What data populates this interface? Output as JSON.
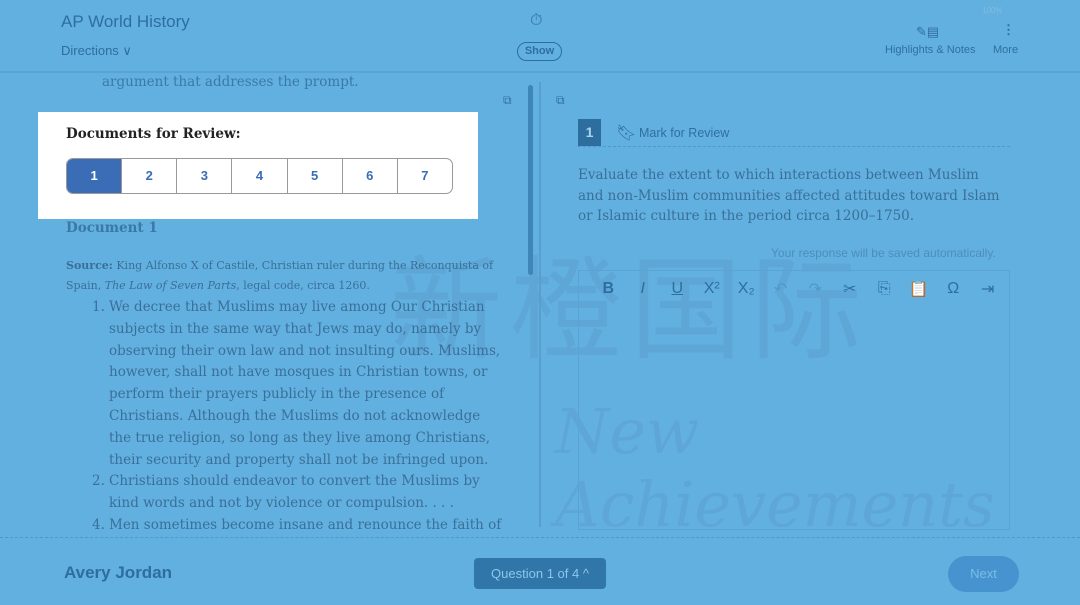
{
  "header": {
    "title": "AP World History",
    "directions": "Directions ∨",
    "battery": "100%",
    "timer_icon": "stopwatch-icon",
    "show": "Show",
    "highlights_notes": "Highlights & Notes",
    "more": "More"
  },
  "passage": {
    "argument": "argument that addresses the prompt.",
    "doc_heading": "Document 1",
    "source_label": "Source:",
    "source_text": " King Alfonso X of Castile, Christian ruler during the Reconquista of Spain, ",
    "source_title": "The Law of Seven Parts",
    "source_rest": ", legal code, circa 1260.",
    "items": [
      {
        "n": "1.",
        "text": "We decree that Muslims may live among Our Christian subjects in the same way that Jews may do, namely by observing their own law and not insulting ours. Muslims, however, shall not have mosques in Christian towns, or perform their prayers publicly in the presence of Christians. Although the Muslims do not acknowledge the true religion, so long as they live among Christians, their security and property shall not be infringed upon."
      },
      {
        "n": "2.",
        "text": "Christians should endeavor to convert the Muslims by kind words and not by violence or compulsion. . . ."
      },
      {
        "n": "4.",
        "text": "Men sometimes become insane and renounce the faith of"
      }
    ]
  },
  "documents": {
    "label": "Documents for Review:",
    "tabs": [
      "1",
      "2",
      "3",
      "4",
      "5",
      "6",
      "7"
    ],
    "active": "1"
  },
  "question": {
    "number": "1",
    "mark": "Mark for Review",
    "prompt": "Evaluate the extent to which interactions between Muslim and non-Muslim communities affected attitudes toward Islam or Islamic culture in the period circa 1200–1750.",
    "saved": "Your response will be saved automatically.",
    "toolbar": [
      "B",
      "I",
      "U",
      "X²",
      "X₂",
      "↶",
      "↷",
      "✂",
      "⎘",
      "📋",
      "Ω",
      "⇥"
    ]
  },
  "footer": {
    "name": "Avery Jordan",
    "question_nav": "Question 1 of 4 ^",
    "next": "Next"
  },
  "watermark": {
    "cn": "新橙国际",
    "en": "New Achievements"
  },
  "colors": {
    "overlay": "#62b0df",
    "active_tab": "#3a6db5"
  }
}
